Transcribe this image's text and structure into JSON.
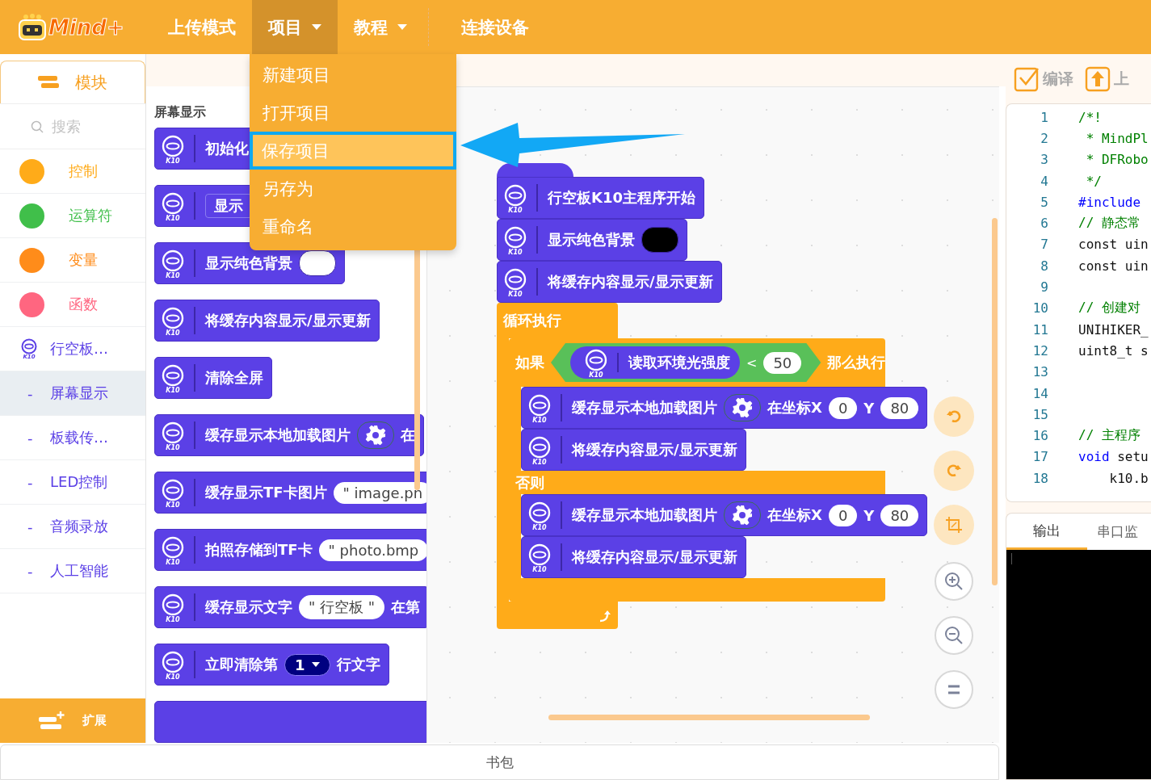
{
  "app": {
    "logo_text": "Mind+"
  },
  "menu_bar": {
    "items": [
      {
        "label": "上传模式",
        "selected": false,
        "has_caret": false
      },
      {
        "label": "项目",
        "selected": true,
        "has_caret": true
      },
      {
        "label": "教程",
        "selected": false,
        "has_caret": true
      }
    ],
    "actions": [
      "连接设备"
    ]
  },
  "project_menu": {
    "items": [
      {
        "label": "新建项目",
        "selected": false
      },
      {
        "label": "打开项目",
        "selected": false
      },
      {
        "label": "保存项目",
        "selected": true
      },
      {
        "label": "另存为",
        "selected": false
      },
      {
        "label": "重命名",
        "selected": false
      }
    ]
  },
  "sidebar": {
    "tab": "模块",
    "search_placeholder": "搜索",
    "categories": [
      {
        "kind": "category",
        "label": "控制",
        "color": "#ffab19",
        "selected": false
      },
      {
        "kind": "category",
        "label": "运算符",
        "color": "#40bf4a",
        "selected": false
      },
      {
        "kind": "category",
        "label": "变量",
        "color": "#ff8c1a",
        "selected": false
      },
      {
        "kind": "category",
        "label": "函数",
        "color": "#ff6680",
        "selected": false
      },
      {
        "kind": "device",
        "label": "行空板…",
        "icon_label": "K10",
        "selected": false
      },
      {
        "kind": "sub",
        "marker": "-",
        "label": "屏幕显示",
        "selected": true
      },
      {
        "kind": "sub",
        "marker": "-",
        "label": "板载传…",
        "selected": false
      },
      {
        "kind": "sub",
        "marker": "-",
        "label": "LED控制",
        "selected": false
      },
      {
        "kind": "sub",
        "marker": "-",
        "label": "音频录放",
        "selected": false
      },
      {
        "kind": "sub",
        "marker": "-",
        "label": "人工智能",
        "selected": false
      }
    ],
    "extension_button": "扩展"
  },
  "palette": {
    "heading": "屏幕显示",
    "blocks": [
      {
        "kind": "block",
        "icon_label": "K10",
        "parts": [
          {
            "kind": "label",
            "text": "初始化"
          }
        ]
      },
      {
        "kind": "block",
        "icon_label": "K10",
        "parts": [
          {
            "kind": "select",
            "text": "显示"
          }
        ]
      },
      {
        "kind": "block",
        "icon_label": "K10",
        "parts": [
          {
            "kind": "label",
            "text": "显示纯色背景"
          },
          {
            "kind": "color",
            "color": "#ffffff"
          }
        ]
      },
      {
        "kind": "block",
        "icon_label": "K10",
        "parts": [
          {
            "kind": "label",
            "text": "将缓存内容显示/显示更新"
          }
        ]
      },
      {
        "kind": "block",
        "icon_label": "K10",
        "parts": [
          {
            "kind": "label",
            "text": "清除全屏"
          }
        ]
      },
      {
        "kind": "block",
        "icon_label": "K10",
        "parts": [
          {
            "kind": "label",
            "text": "缓存显示本地加载图片"
          },
          {
            "kind": "gear"
          },
          {
            "kind": "label",
            "text": "在"
          }
        ]
      },
      {
        "kind": "block",
        "icon_label": "K10",
        "parts": [
          {
            "kind": "label",
            "text": "缓存显示TF卡图片"
          },
          {
            "kind": "string",
            "text": "\" image.pn"
          }
        ]
      },
      {
        "kind": "block",
        "icon_label": "K10",
        "parts": [
          {
            "kind": "label",
            "text": "拍照存储到TF卡"
          },
          {
            "kind": "string",
            "text": "\" photo.bmp"
          }
        ]
      },
      {
        "kind": "block",
        "icon_label": "K10",
        "parts": [
          {
            "kind": "label",
            "text": "缓存显示文字"
          },
          {
            "kind": "string",
            "text": "\" 行空板 \""
          },
          {
            "kind": "label",
            "text": "在第"
          }
        ]
      },
      {
        "kind": "block",
        "icon_label": "K10",
        "parts": [
          {
            "kind": "label",
            "text": "立即清除第"
          },
          {
            "kind": "dropdown",
            "text": "1"
          },
          {
            "kind": "label",
            "text": "行文字"
          }
        ]
      },
      {
        "kind": "partial"
      }
    ]
  },
  "canvas": {
    "script": [
      {
        "kind": "hat",
        "icon_label": "K10",
        "parts": [
          {
            "kind": "label",
            "text": "行空板K10主程序开始"
          }
        ]
      },
      {
        "kind": "stack",
        "icon_label": "K10",
        "parts": [
          {
            "kind": "label",
            "text": "显示纯色背景"
          },
          {
            "kind": "color",
            "color": "#000000"
          }
        ]
      },
      {
        "kind": "stack",
        "icon_label": "K10",
        "parts": [
          {
            "kind": "label",
            "text": "将缓存内容显示/显示更新"
          }
        ]
      },
      {
        "kind": "loop",
        "label": "循环执行",
        "body": [
          {
            "kind": "if-else",
            "if_label": "如果",
            "then_label": "那么执行",
            "else_label": "否则",
            "condition": {
              "icon_label": "K10",
              "label": "读取环境光强度",
              "operator": "<",
              "value": "50"
            },
            "then": [
              {
                "kind": "stack",
                "icon_label": "K10",
                "parts": [
                  {
                    "kind": "label",
                    "text": "缓存显示本地加载图片"
                  },
                  {
                    "kind": "gear"
                  },
                  {
                    "kind": "label",
                    "text": "在坐标X"
                  },
                  {
                    "kind": "number",
                    "text": "0"
                  },
                  {
                    "kind": "label",
                    "text": "Y"
                  },
                  {
                    "kind": "number",
                    "text": "80"
                  }
                ]
              },
              {
                "kind": "stack",
                "icon_label": "K10",
                "parts": [
                  {
                    "kind": "label",
                    "text": "将缓存内容显示/显示更新"
                  }
                ]
              }
            ],
            "else": [
              {
                "kind": "stack",
                "icon_label": "K10",
                "parts": [
                  {
                    "kind": "label",
                    "text": "缓存显示本地加载图片"
                  },
                  {
                    "kind": "gear"
                  },
                  {
                    "kind": "label",
                    "text": "在坐标X"
                  },
                  {
                    "kind": "number",
                    "text": "0"
                  },
                  {
                    "kind": "label",
                    "text": "Y"
                  },
                  {
                    "kind": "number",
                    "text": "80"
                  }
                ]
              },
              {
                "kind": "stack",
                "icon_label": "K10",
                "parts": [
                  {
                    "kind": "label",
                    "text": "将缓存内容显示/显示更新"
                  }
                ]
              }
            ]
          }
        ]
      }
    ]
  },
  "toolbar": {
    "compile": "编译",
    "upload": "上"
  },
  "code_editor": {
    "lines": [
      {
        "number": "1",
        "parts": [
          {
            "text": "/*!",
            "kind": "comment"
          }
        ]
      },
      {
        "number": "2",
        "parts": [
          {
            "text": " * MindPl",
            "kind": "comment"
          }
        ]
      },
      {
        "number": "3",
        "parts": [
          {
            "text": " * DFRobo",
            "kind": "comment"
          }
        ]
      },
      {
        "number": "4",
        "parts": [
          {
            "text": " */",
            "kind": "comment"
          }
        ]
      },
      {
        "number": "5",
        "parts": [
          {
            "text": "#include",
            "kind": "keyword"
          }
        ]
      },
      {
        "number": "6",
        "parts": [
          {
            "text": "// 静态常",
            "kind": "comment"
          }
        ]
      },
      {
        "number": "7",
        "parts": [
          {
            "text": "const uin",
            "kind": "plain"
          }
        ]
      },
      {
        "number": "8",
        "parts": [
          {
            "text": "const uin",
            "kind": "plain"
          }
        ]
      },
      {
        "number": "9"
      },
      {
        "number": "10",
        "parts": [
          {
            "text": "// 创建对",
            "kind": "comment"
          }
        ]
      },
      {
        "number": "11",
        "parts": [
          {
            "text": "UNIHIKER_",
            "kind": "plain"
          }
        ]
      },
      {
        "number": "12",
        "parts": [
          {
            "text": "uint8_t s",
            "kind": "plain"
          }
        ]
      },
      {
        "number": "13"
      },
      {
        "number": "14"
      },
      {
        "number": "15"
      },
      {
        "number": "16",
        "parts": [
          {
            "text": "// 主程序",
            "kind": "comment"
          }
        ]
      },
      {
        "number": "17",
        "parts": [
          {
            "text": "void",
            "kind": "keyword"
          },
          {
            "text": " setu",
            "kind": "plain"
          }
        ]
      },
      {
        "number": "18",
        "parts": [
          {
            "text": "    k10.b",
            "kind": "plain"
          }
        ]
      }
    ]
  },
  "output_panel": {
    "tabs": [
      {
        "label": "输出",
        "selected": true
      },
      {
        "label": "串口监",
        "selected": false
      }
    ]
  },
  "bottom_bar": {
    "label": "书包"
  }
}
